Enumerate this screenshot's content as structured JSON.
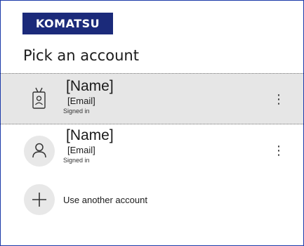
{
  "brand": {
    "logo_text": "KOMATSU",
    "logo_color": "#1b2a7a"
  },
  "title": "Pick an account",
  "accounts": [
    {
      "name": "[Name]",
      "email": "[Email]",
      "status": "Signed in",
      "icon": "badge-icon",
      "selected": true
    },
    {
      "name": "[Name]",
      "email": "[Email]",
      "status": "Signed in",
      "icon": "person-icon",
      "selected": false
    }
  ],
  "add_account": {
    "label": "Use another account",
    "icon": "plus-icon"
  },
  "more_glyph": "⋮"
}
